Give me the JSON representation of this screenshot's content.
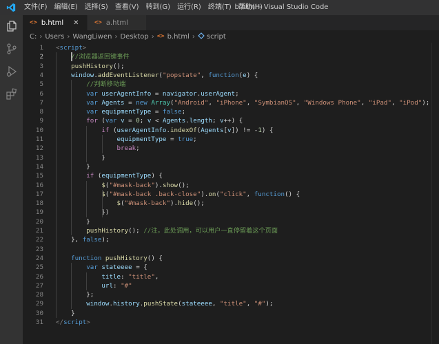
{
  "window": {
    "title": "b.html - Visual Studio Code",
    "menu": [
      "文件(F)",
      "编辑(E)",
      "选择(S)",
      "查看(V)",
      "转到(G)",
      "运行(R)",
      "终端(T)",
      "帮助(H)"
    ]
  },
  "tabs": [
    {
      "label": "b.html",
      "icon": "<>",
      "active": true,
      "close": "✕"
    },
    {
      "label": "a.html",
      "icon": "<>",
      "active": false
    }
  ],
  "breadcrumb": [
    "C:",
    "Users",
    "WangLiwen",
    "Desktop",
    "b.html",
    "script"
  ],
  "breadcrumb_file_icon": "<>",
  "code": {
    "current_line": 2,
    "lines": [
      [
        [
          "tb",
          "<"
        ],
        [
          "tag",
          "script"
        ],
        [
          "tb",
          ">"
        ]
      ],
      [
        [
          "c",
          "    //浏览器返回键事件"
        ]
      ],
      [
        [
          "f",
          "    pushHistory"
        ],
        [
          "p",
          "();"
        ]
      ],
      [
        [
          "v",
          "    window"
        ],
        [
          "p",
          "."
        ],
        [
          "f",
          "addEventListener"
        ],
        [
          "p",
          "("
        ],
        [
          "s",
          "\"popstate\""
        ],
        [
          "p",
          ", "
        ],
        [
          "k",
          "function"
        ],
        [
          "p",
          "("
        ],
        [
          "v",
          "e"
        ],
        [
          "p",
          ") {"
        ]
      ],
      [
        [
          "c",
          "        //判断移动端"
        ]
      ],
      [
        [
          "k",
          "        var "
        ],
        [
          "v",
          "userAgentInfo"
        ],
        [
          "p",
          " = "
        ],
        [
          "v",
          "navigator"
        ],
        [
          "p",
          "."
        ],
        [
          "v",
          "userAgent"
        ],
        [
          "p",
          ";"
        ]
      ],
      [
        [
          "k",
          "        var "
        ],
        [
          "v",
          "Agents"
        ],
        [
          "p",
          " = "
        ],
        [
          "k",
          "new "
        ],
        [
          "t",
          "Array"
        ],
        [
          "p",
          "("
        ],
        [
          "s",
          "\"Android\""
        ],
        [
          "p",
          ", "
        ],
        [
          "s",
          "\"iPhone\""
        ],
        [
          "p",
          ", "
        ],
        [
          "s",
          "\"SymbianOS\""
        ],
        [
          "p",
          ", "
        ],
        [
          "s",
          "\"Windows Phone\""
        ],
        [
          "p",
          ", "
        ],
        [
          "s",
          "\"iPad\""
        ],
        [
          "p",
          ", "
        ],
        [
          "s",
          "\"iPod\""
        ],
        [
          "p",
          ");"
        ]
      ],
      [
        [
          "k",
          "        var "
        ],
        [
          "v",
          "equipmentType"
        ],
        [
          "p",
          " = "
        ],
        [
          "k",
          "false"
        ],
        [
          "p",
          ";"
        ]
      ],
      [
        [
          "cf",
          "        for "
        ],
        [
          "p",
          "("
        ],
        [
          "k",
          "var "
        ],
        [
          "v",
          "v"
        ],
        [
          "p",
          " = "
        ],
        [
          "n",
          "0"
        ],
        [
          "p",
          "; "
        ],
        [
          "v",
          "v"
        ],
        [
          "p",
          " < "
        ],
        [
          "v",
          "Agents"
        ],
        [
          "p",
          "."
        ],
        [
          "v",
          "length"
        ],
        [
          "p",
          "; "
        ],
        [
          "v",
          "v"
        ],
        [
          "p",
          "++) {"
        ]
      ],
      [
        [
          "cf",
          "            if "
        ],
        [
          "p",
          "("
        ],
        [
          "v",
          "userAgentInfo"
        ],
        [
          "p",
          "."
        ],
        [
          "f",
          "indexOf"
        ],
        [
          "p",
          "("
        ],
        [
          "v",
          "Agents"
        ],
        [
          "p",
          "["
        ],
        [
          "v",
          "v"
        ],
        [
          "p",
          "]) != -"
        ],
        [
          "n",
          "1"
        ],
        [
          "p",
          ") {"
        ]
      ],
      [
        [
          "v",
          "                equipmentType"
        ],
        [
          "p",
          " = "
        ],
        [
          "k",
          "true"
        ],
        [
          "p",
          ";"
        ]
      ],
      [
        [
          "cf",
          "                break"
        ],
        [
          "p",
          ";"
        ]
      ],
      [
        [
          "p",
          "            }"
        ]
      ],
      [
        [
          "p",
          "        }"
        ]
      ],
      [
        [
          "cf",
          "        if "
        ],
        [
          "p",
          "("
        ],
        [
          "v",
          "equipmentType"
        ],
        [
          "p",
          ") {"
        ]
      ],
      [
        [
          "f",
          "            $"
        ],
        [
          "p",
          "("
        ],
        [
          "s",
          "\"#mask-back\""
        ],
        [
          "p",
          ")."
        ],
        [
          "f",
          "show"
        ],
        [
          "p",
          "();"
        ]
      ],
      [
        [
          "f",
          "            $"
        ],
        [
          "p",
          "("
        ],
        [
          "s",
          "\"#mask-back .back-close\""
        ],
        [
          "p",
          ")."
        ],
        [
          "f",
          "on"
        ],
        [
          "p",
          "("
        ],
        [
          "s",
          "\"click\""
        ],
        [
          "p",
          ", "
        ],
        [
          "k",
          "function"
        ],
        [
          "p",
          "() {"
        ]
      ],
      [
        [
          "f",
          "                $"
        ],
        [
          "p",
          "("
        ],
        [
          "s",
          "\"#mask-back\""
        ],
        [
          "p",
          ")."
        ],
        [
          "f",
          "hide"
        ],
        [
          "p",
          "();"
        ]
      ],
      [
        [
          "p",
          "            })"
        ]
      ],
      [
        [
          "p",
          "        }"
        ]
      ],
      [
        [
          "f",
          "        pushHistory"
        ],
        [
          "p",
          "(); "
        ],
        [
          "c",
          "//注，此处调用，可以用户一直停留着这个页面"
        ]
      ],
      [
        [
          "p",
          "    }, "
        ],
        [
          "k",
          "false"
        ],
        [
          "p",
          ");"
        ]
      ],
      [
        [
          "p",
          ""
        ]
      ],
      [
        [
          "k",
          "    function "
        ],
        [
          "f",
          "pushHistory"
        ],
        [
          "p",
          "() {"
        ]
      ],
      [
        [
          "k",
          "        var "
        ],
        [
          "v",
          "stateeee"
        ],
        [
          "p",
          " = {"
        ]
      ],
      [
        [
          "v",
          "            title"
        ],
        [
          "p",
          ": "
        ],
        [
          "s",
          "\"title\""
        ],
        [
          "p",
          ","
        ]
      ],
      [
        [
          "v",
          "            url"
        ],
        [
          "p",
          ": "
        ],
        [
          "s",
          "\"#\""
        ]
      ],
      [
        [
          "p",
          "        };"
        ]
      ],
      [
        [
          "v",
          "        window"
        ],
        [
          "p",
          "."
        ],
        [
          "v",
          "history"
        ],
        [
          "p",
          "."
        ],
        [
          "f",
          "pushState"
        ],
        [
          "p",
          "("
        ],
        [
          "v",
          "stateeee"
        ],
        [
          "p",
          ", "
        ],
        [
          "s",
          "\"title\""
        ],
        [
          "p",
          ", "
        ],
        [
          "s",
          "\"#\""
        ],
        [
          "p",
          ");"
        ]
      ],
      [
        [
          "p",
          "    }"
        ]
      ],
      [
        [
          "tb",
          "</"
        ],
        [
          "tag",
          "script"
        ],
        [
          "tb",
          ">"
        ]
      ]
    ]
  },
  "icons": {
    "activity": [
      "files-icon",
      "source-control-icon",
      "run-debug-icon",
      "extensions-icon"
    ]
  },
  "colors": {
    "accent": "#007acc",
    "titlebar": "#323233",
    "activitybar": "#333333",
    "editor_bg": "#1e1e1e",
    "html_file_icon": "#e37933"
  }
}
